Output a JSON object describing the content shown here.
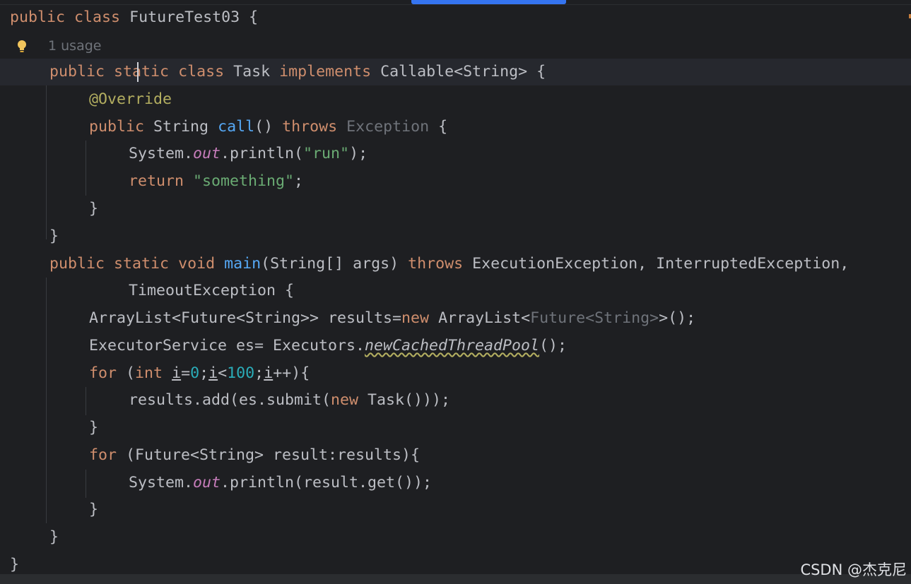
{
  "editor": {
    "usage_hint": "1 usage",
    "lines": {
      "l1": {
        "kw_public": "public",
        "kw_class": "class",
        "name": "FutureTest03",
        "brace": " {"
      },
      "l3": {
        "kw_public": "public",
        "kw_static": "static",
        "kw_class": "class",
        "name": "Task",
        "kw_implements": "implements",
        "iface": "Callable<String>",
        "brace": " {"
      },
      "l4": {
        "annotation": "@Override"
      },
      "l5": {
        "kw_public": "public",
        "type": "String",
        "method": "call",
        "parens": "()",
        "kw_throws": "throws",
        "exception": "Exception",
        "brace": " {"
      },
      "l6": {
        "system": "System.",
        "out": "out",
        "println_open": ".println(",
        "str": "\"run\"",
        "close": ");"
      },
      "l7": {
        "kw_return": "return",
        "str": "\"something\"",
        "semi": ";"
      },
      "l8": {
        "brace": "}"
      },
      "l9": {
        "brace": "}"
      },
      "l10": {
        "kw_public": "public",
        "kw_static": "static",
        "kw_void": "void",
        "method": "main",
        "params": "(String[] args)",
        "kw_throws": "throws",
        "exceptions": "ExecutionException, InterruptedException,"
      },
      "l11": {
        "exception": "TimeoutException",
        "brace": " {"
      },
      "l12": {
        "decl": "ArrayList<Future<String>> results=",
        "kw_new": "new",
        "type": "ArrayList<",
        "generic_gray": "Future<String>",
        "close": ">();"
      },
      "l13": {
        "decl": "ExecutorService es= Executors.",
        "static_call": "newCachedThreadPool",
        "close": "();"
      },
      "l14": {
        "kw_for": "for",
        "open": " (",
        "kw_int": "int",
        "var1": "i",
        "eq": "=",
        "num0": "0",
        "semi1": ";",
        "var2": "i",
        "lt": "<",
        "num100": "100",
        "semi2": ";",
        "var3": "i",
        "inc": "++){"
      },
      "l15": {
        "pre": "results.add(es.submit(",
        "kw_new": "new",
        "post": " Task()));"
      },
      "l16": {
        "brace": "}"
      },
      "l17": {
        "kw_for": "for",
        "rest": " (Future<String> result:results){"
      },
      "l18": {
        "system": "System.",
        "out": "out",
        "rest": ".println(result.get());"
      },
      "l19": {
        "brace": "}"
      },
      "l20": {
        "brace": "}"
      },
      "l21": {
        "brace": "}"
      }
    }
  },
  "watermark": "CSDN @杰克尼",
  "colors": {
    "background": "#1e1f22",
    "keyword": "#cf8e6d",
    "string": "#6aab73",
    "number": "#2aacb8",
    "function": "#56a8f5",
    "annotation": "#b3ae60",
    "static_field": "#c77dbb",
    "text": "#bcbec4",
    "accent": "#3574f0"
  }
}
